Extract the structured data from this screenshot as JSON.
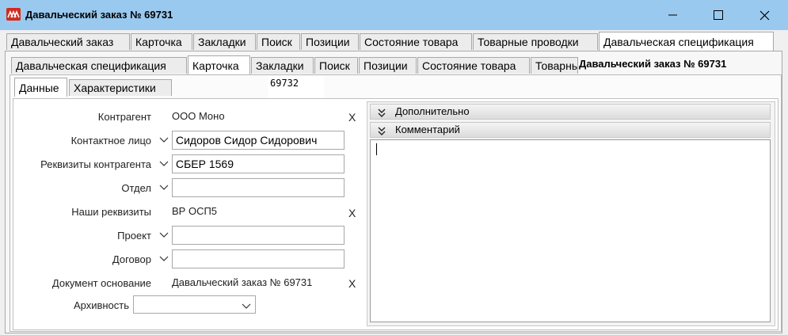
{
  "window": {
    "title": "Давальческий заказ № 69731"
  },
  "tabs_top": [
    {
      "label": "Давальческий заказ"
    },
    {
      "label": "Карточка"
    },
    {
      "label": "Закладки"
    },
    {
      "label": "Поиск"
    },
    {
      "label": "Позиции"
    },
    {
      "label": "Состояние товара"
    },
    {
      "label": "Товарные проводки"
    },
    {
      "label": "Давальческая спецификация"
    }
  ],
  "tabs_second": [
    {
      "label": "Давальческая спецификация"
    },
    {
      "label": "Карточка"
    },
    {
      "label": "Закладки"
    },
    {
      "label": "Поиск"
    },
    {
      "label": "Позиции"
    },
    {
      "label": "Состояние товара"
    },
    {
      "label": "Товарные"
    }
  ],
  "tabs_third": [
    {
      "label": "Данные"
    },
    {
      "label": "Характеристики"
    }
  ],
  "header_right_title": "Давальческий заказ № 69731",
  "spec_number": "69732",
  "form": {
    "counterparty": {
      "label": "Контрагент",
      "value": "ООО Моно",
      "clear": "X"
    },
    "contact": {
      "label": "Контактное лицо",
      "value": "Сидоров Сидор Сидорович"
    },
    "requisites": {
      "label": "Реквизиты контрагента",
      "value": "СБЕР 1569"
    },
    "department": {
      "label": "Отдел",
      "value": ""
    },
    "our_requisites": {
      "label": "Наши реквизиты",
      "value": "ВР ОСП5",
      "clear": "X"
    },
    "project": {
      "label": "Проект",
      "value": ""
    },
    "contract": {
      "label": "Договор",
      "value": ""
    },
    "base_document": {
      "label": "Документ основание",
      "value": "Давальческий заказ № 69731",
      "clear": "X"
    },
    "archive": {
      "label": "Архивность",
      "value": ""
    }
  },
  "right_panel": {
    "additional": "Дополнительно",
    "comment": "Комментарий",
    "comment_text": ""
  },
  "colors": {
    "titlebar": "#99c9ef",
    "logo": "#d42a1e"
  }
}
